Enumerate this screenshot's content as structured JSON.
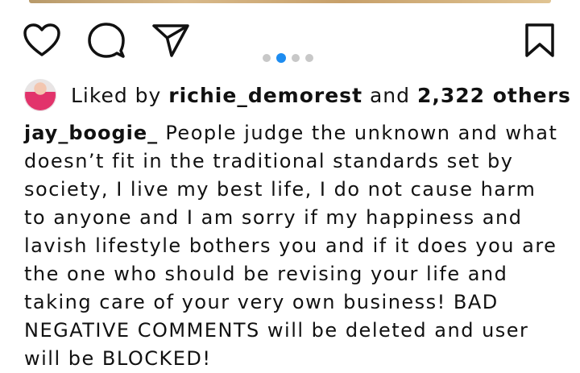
{
  "post": {
    "likes": {
      "prefix": "Liked by",
      "user": "richie_demorest",
      "connector": "and",
      "others": "2,322 others"
    },
    "carousel": {
      "count": 4,
      "active_index": 1
    },
    "caption": {
      "username": "jay_boogie_",
      "text": "People judge the unknown and what doesn’t fit in the traditional standards set by society, I live my best life, I do not cause harm to anyone and I am sorry if my happiness and lavish lifestyle bothers you and if it does you are the one who should be revising your life and taking care of your very own business! BAD NEGATIVE COMMENTS will be deleted and user will be BLOCKED!"
    }
  },
  "icons": {
    "like": "heart-icon",
    "comment": "comment-icon",
    "share": "send-icon",
    "save": "bookmark-icon"
  },
  "colors": {
    "text": "#111111",
    "accent": "#1d8cf0",
    "dot_inactive": "#c8c8c8"
  }
}
